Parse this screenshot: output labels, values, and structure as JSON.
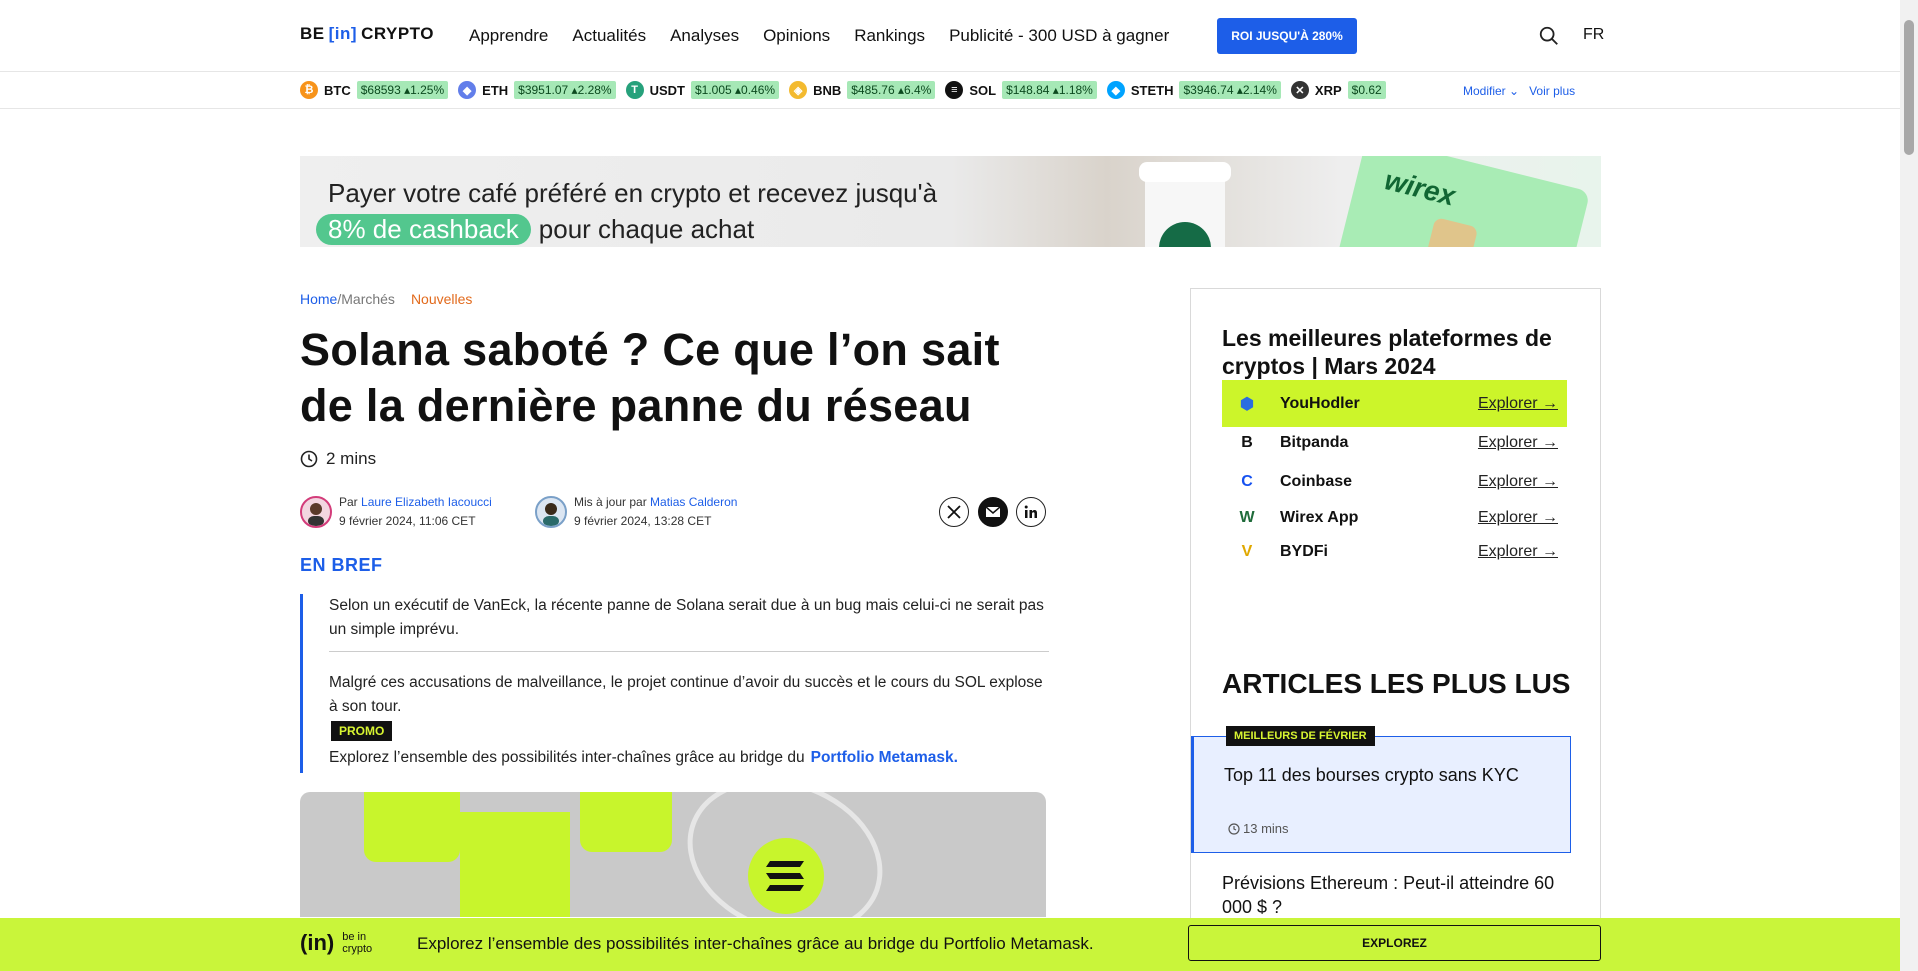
{
  "header": {
    "logo": {
      "be": "BE",
      "in": "[in]",
      "crypto": "CRYPTO"
    },
    "nav": [
      "Apprendre",
      "Actualités",
      "Analyses",
      "Opinions",
      "Rankings",
      "Publicité - 300 USD à gagner"
    ],
    "roi_button": "ROI JUSQU'À 280%",
    "lang": "FR"
  },
  "ticker": {
    "items": [
      {
        "symbol": "BTC",
        "value": "$68593 ▴1.25%",
        "color": "#f7931a",
        "icon": "bitcoin-icon"
      },
      {
        "symbol": "ETH",
        "value": "$3951.07 ▴2.28%",
        "color": "#627eea",
        "icon": "ethereum-icon"
      },
      {
        "symbol": "USDT",
        "value": "$1.005 ▴0.46%",
        "color": "#26a17b",
        "icon": "tether-icon"
      },
      {
        "symbol": "BNB",
        "value": "$485.76 ▴6.4%",
        "color": "#f3ba2f",
        "icon": "bnb-icon"
      },
      {
        "symbol": "SOL",
        "value": "$148.84 ▴1.18%",
        "color": "#111111",
        "icon": "solana-icon"
      },
      {
        "symbol": "STETH",
        "value": "$3946.74 ▴2.14%",
        "color": "#00a3ff",
        "icon": "steth-icon"
      },
      {
        "symbol": "XRP",
        "value": "$0.62",
        "color": "#333333",
        "icon": "xrp-icon"
      }
    ],
    "modify": "Modifier",
    "see_more": "Voir plus"
  },
  "banner": {
    "line1": "Payer votre café préféré en crypto et recevez jusqu'à",
    "cashback": "8% de cashback",
    "line2_rest": "pour chaque achat",
    "brand": "wirex"
  },
  "breadcrumb": {
    "home": "Home",
    "sep": "/",
    "markets": "Marchés",
    "news": "Nouvelles"
  },
  "article": {
    "title": "Solana saboté ? Ce que l’on sait de la dernière panne du réseau",
    "read_time": "2 mins",
    "author1": {
      "prefix": "Par",
      "name": "Laure Elizabeth Iacoucci",
      "date": "9 février 2024, 11:06 CET"
    },
    "author2": {
      "prefix": "Mis à jour par",
      "name": "Matias Calderon",
      "date": "9 février 2024, 13:28 CET"
    },
    "en_bref": "EN BREF",
    "bref1": "Selon un exécutif de VanEck, la récente panne de Solana serait due à un bug mais celui-ci ne serait pas un simple imprévu.",
    "bref2": "Malgré ces accusations de malveillance, le projet continue d’avoir du succès et le cours du SOL explose à son tour.",
    "promo": "PROMO",
    "promo_text": "Explorez l’ensemble des possibilités inter-chaînes grâce au bridge du",
    "promo_link": "Portfolio Metamask."
  },
  "sidebar": {
    "title": "Les meilleures plateformes de cryptos | Mars 2024",
    "platforms": [
      {
        "name": "YouHodler",
        "link": "Explorer →",
        "icon": "youhodler-icon",
        "color": "#2a6de0"
      },
      {
        "name": "Bitpanda",
        "link": "Explorer →",
        "icon": "bitpanda-icon",
        "color": "#111111"
      },
      {
        "name": "Coinbase",
        "link": "Explorer →",
        "icon": "coinbase-icon",
        "color": "#1652f0"
      },
      {
        "name": "Wirex App",
        "link": "Explorer →",
        "icon": "wirex-icon",
        "color": "#1f6b3a"
      },
      {
        "name": "BYDFi",
        "link": "Explorer →",
        "icon": "bydfi-icon",
        "color": "#e0a800"
      }
    ],
    "most_read": "ARTICLES LES PLUS LUS",
    "featured": {
      "badge": "MEILLEURS DE FÉVRIER",
      "title": "Top 11 des bourses crypto sans KYC",
      "time": "13 mins"
    },
    "article2": "Prévisions Ethereum : Peut-il atteindre 60 000 $ ?"
  },
  "bottom_bar": {
    "logo_in": "(in)",
    "logo_sub1": "be in",
    "logo_sub2": "crypto",
    "text": "Explorez l’ensemble des possibilités inter-chaînes grâce au bridge du Portfolio Metamask.",
    "button": "EXPLOREZ"
  }
}
